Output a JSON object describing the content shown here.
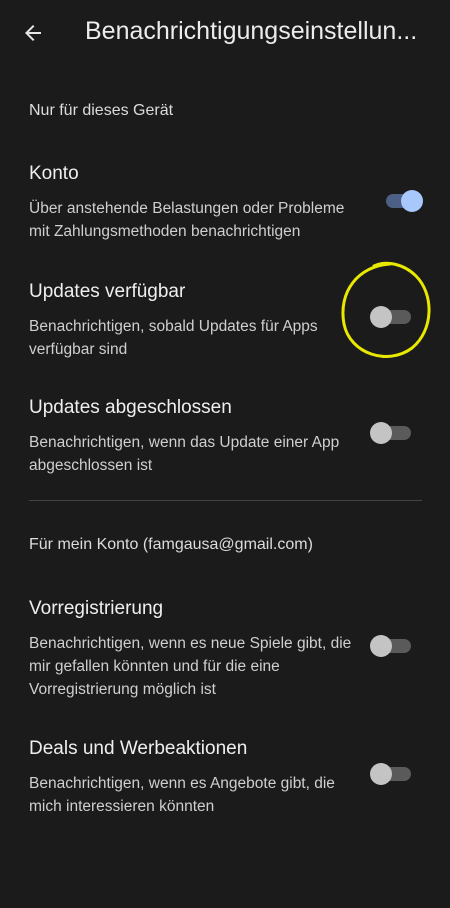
{
  "header": {
    "back_icon": "arrow-left-icon",
    "title": "Benachrichtigungseinstellun..."
  },
  "device_section": {
    "header": "Nur für dieses Gerät",
    "items": [
      {
        "title": "Konto",
        "description": "Über anstehende Belastungen oder Probleme mit Zahlungsmethoden benachrichtigen",
        "enabled": true
      },
      {
        "title": "Updates verfügbar",
        "description": "Benachrichtigen, sobald Updates für Apps verfügbar sind",
        "enabled": false
      },
      {
        "title": "Updates abgeschlossen",
        "description": "Benachrichtigen, wenn das Update einer App abgeschlossen ist",
        "enabled": false
      }
    ]
  },
  "account_section": {
    "header": "Für mein Konto (famgausa@gmail.com)",
    "items": [
      {
        "title": "Vorregistrierung",
        "description": "Benachrichtigen, wenn es neue Spiele gibt, die mir gefallen könnten und für die eine Vorregistrierung möglich ist",
        "enabled": false
      },
      {
        "title": "Deals und Werbeaktionen",
        "description": "Benachrichtigen, wenn es Angebote gibt, die mich interessieren könnten",
        "enabled": false
      }
    ]
  },
  "colors": {
    "background": "#1b1b1b",
    "toggle_on_thumb": "#a8c7fa",
    "annotation": "#e8e800"
  }
}
